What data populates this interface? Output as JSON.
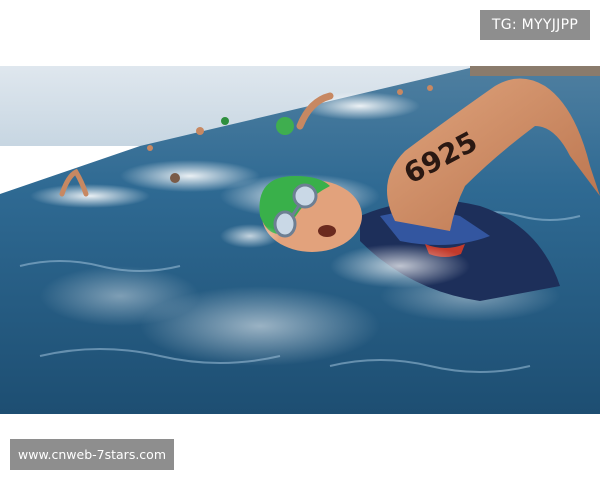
{
  "top_tag": {
    "text": "TG: MYYJJPP"
  },
  "photo": {
    "subject": "open-water swimmer with green cap and goggles",
    "arm_marking": "6925"
  },
  "watermark": {
    "text": "www.cnweb-7stars.com"
  }
}
